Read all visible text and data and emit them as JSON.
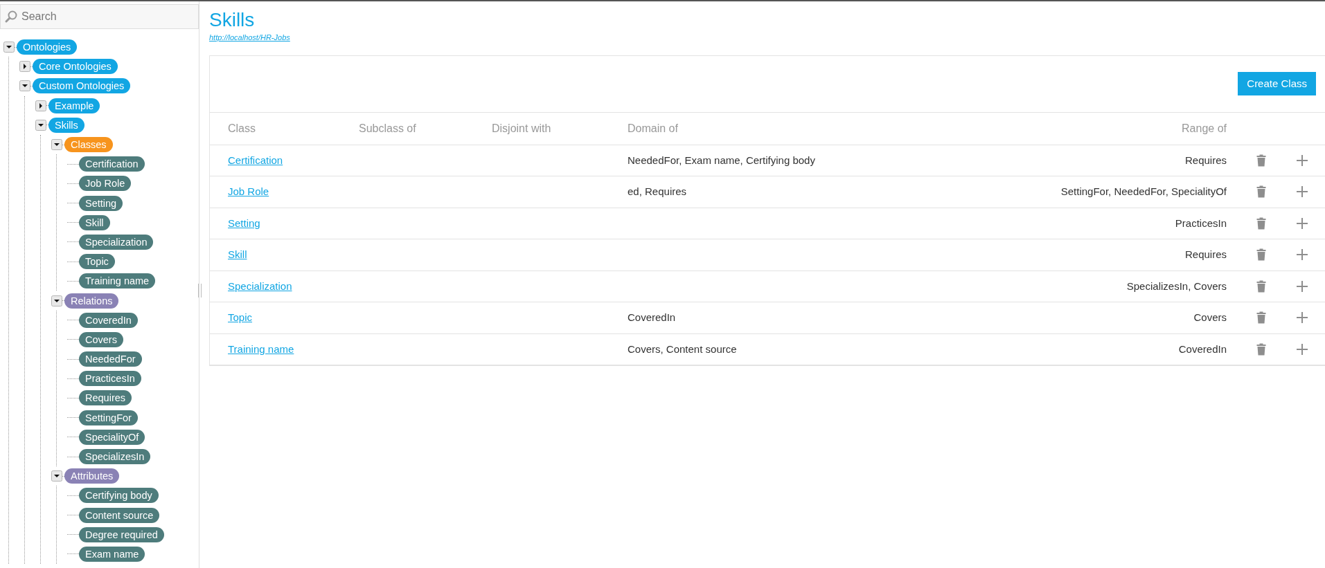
{
  "search": {
    "placeholder": "Search"
  },
  "tree": [
    {
      "label": "Ontologies",
      "kind": "ontology",
      "expanded": true,
      "children": [
        {
          "label": "Core Ontologies",
          "kind": "ontology",
          "expanded": false
        },
        {
          "label": "Custom Ontologies",
          "kind": "ontology",
          "expanded": true,
          "children": [
            {
              "label": "Example",
              "kind": "ontology",
              "expanded": false
            },
            {
              "label": "Skills",
              "kind": "ontology",
              "expanded": true,
              "children": [
                {
                  "label": "Classes",
                  "kind": "classes",
                  "expanded": true,
                  "children": [
                    {
                      "label": "Certification",
                      "kind": "item"
                    },
                    {
                      "label": "Job Role",
                      "kind": "item"
                    },
                    {
                      "label": "Setting",
                      "kind": "item"
                    },
                    {
                      "label": "Skill",
                      "kind": "item"
                    },
                    {
                      "label": "Specialization",
                      "kind": "item"
                    },
                    {
                      "label": "Topic",
                      "kind": "item"
                    },
                    {
                      "label": "Training name",
                      "kind": "item"
                    }
                  ]
                },
                {
                  "label": "Relations",
                  "kind": "group",
                  "expanded": true,
                  "children": [
                    {
                      "label": "CoveredIn",
                      "kind": "item"
                    },
                    {
                      "label": "Covers",
                      "kind": "item"
                    },
                    {
                      "label": "NeededFor",
                      "kind": "item"
                    },
                    {
                      "label": "PracticesIn",
                      "kind": "item"
                    },
                    {
                      "label": "Requires",
                      "kind": "item"
                    },
                    {
                      "label": "SettingFor",
                      "kind": "item"
                    },
                    {
                      "label": "SpecialityOf",
                      "kind": "item"
                    },
                    {
                      "label": "SpecializesIn",
                      "kind": "item"
                    }
                  ]
                },
                {
                  "label": "Attributes",
                  "kind": "group",
                  "expanded": true,
                  "children": [
                    {
                      "label": "Certifying body",
                      "kind": "item"
                    },
                    {
                      "label": "Content source",
                      "kind": "item"
                    },
                    {
                      "label": "Degree required",
                      "kind": "item"
                    },
                    {
                      "label": "Exam name",
                      "kind": "item"
                    }
                  ]
                }
              ]
            }
          ]
        }
      ]
    }
  ],
  "page": {
    "title": "Skills",
    "url": "http://localhost/HR-Jobs"
  },
  "create_button": "Create Class",
  "table": {
    "columns": [
      "Class",
      "Subclass of",
      "Disjoint with",
      "Domain of",
      "Range of"
    ],
    "rows": [
      {
        "class": "Certification",
        "domain_of": "NeededFor, Exam name, Certifying body",
        "range_of": "Requires"
      },
      {
        "class": "Job Role",
        "domain_of": "ed, Requires",
        "range_of": "SettingFor, NeededFor, SpecialityOf"
      },
      {
        "class": "Setting",
        "range_of": "PracticesIn"
      },
      {
        "class": "Skill",
        "range_of": "Requires"
      },
      {
        "class": "Specialization",
        "range_of": "SpecializesIn, Covers"
      },
      {
        "class": "Topic",
        "domain_of": "CoveredIn",
        "range_of": "Covers"
      },
      {
        "class": "Training name",
        "domain_of": "Covers, Content source",
        "range_of": "CoveredIn"
      }
    ]
  }
}
